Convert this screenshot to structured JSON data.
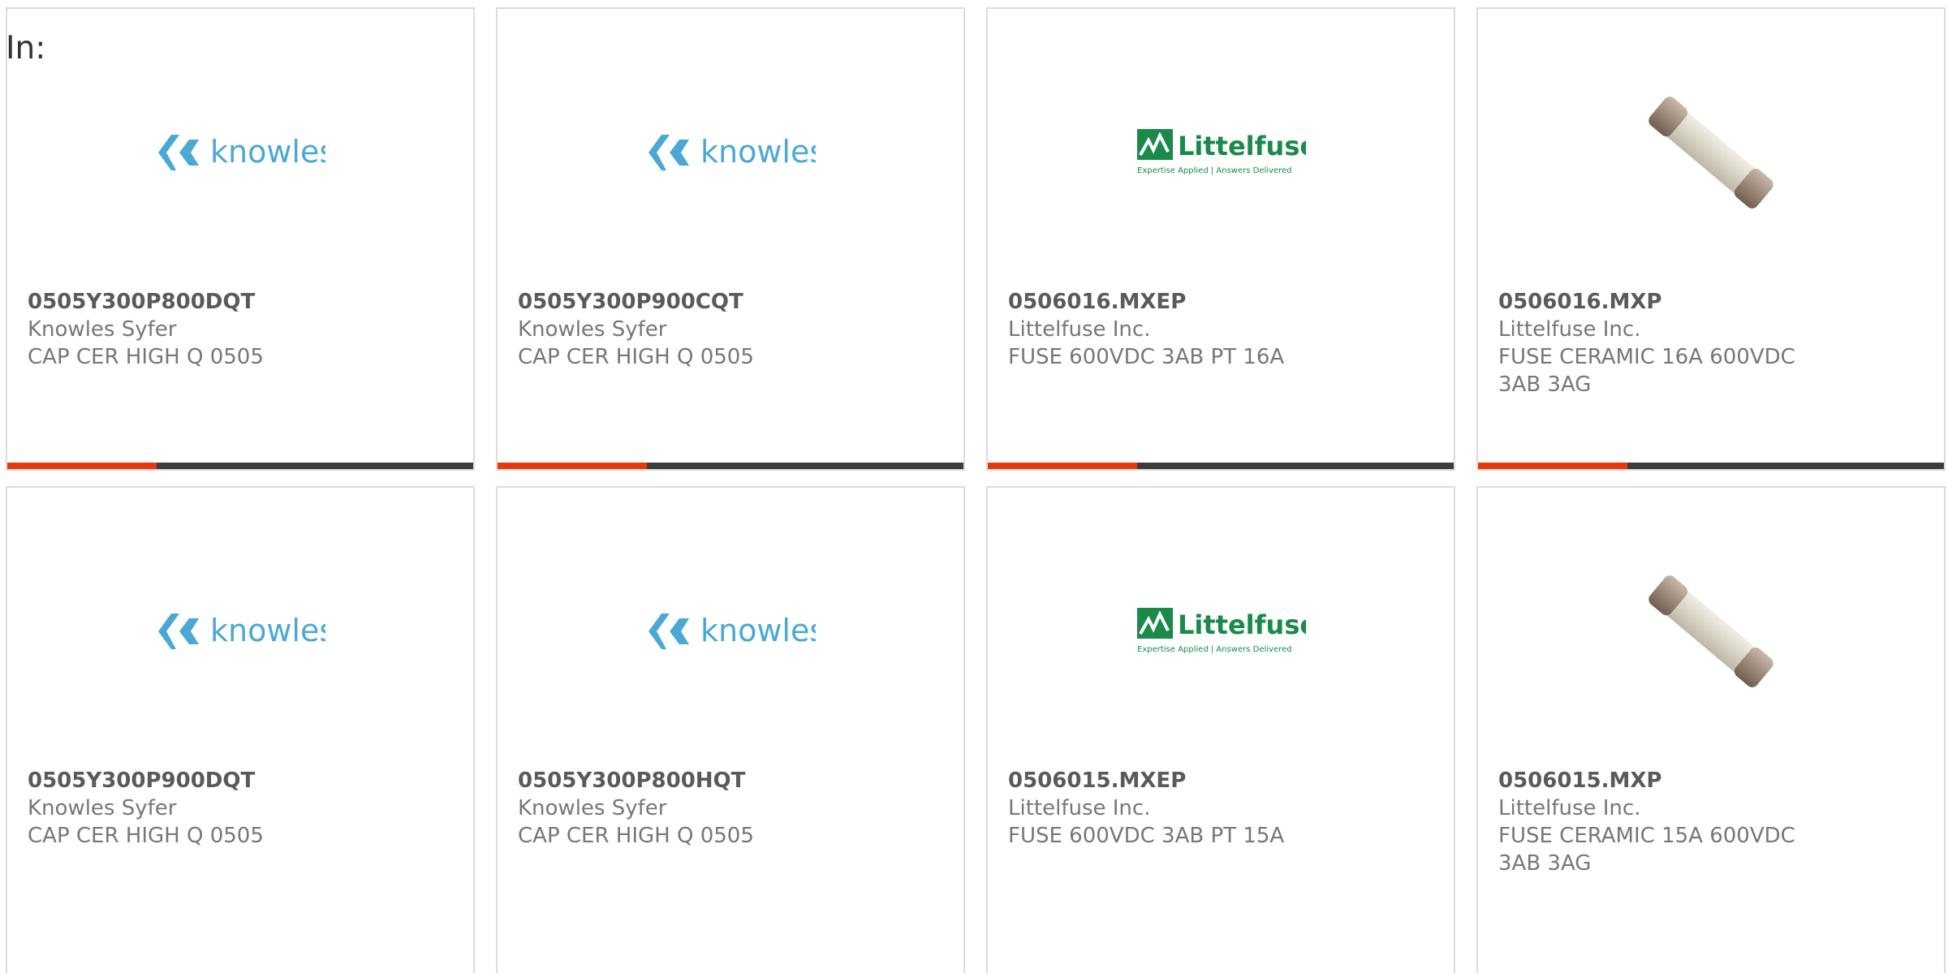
{
  "filter_label": "In:",
  "colors": {
    "bar_accent": "#e8380d",
    "bar_track": "#3d3d3d",
    "knowles_blue": "#4aa9d4",
    "littelfuse_green": "#1a8a4a"
  },
  "products": [
    {
      "part_number": "0505Y300P800DQT",
      "manufacturer": "Knowles Syfer",
      "description": "CAP CER HIGH Q 0505",
      "image": "knowles-logo",
      "logo_text": "knowles",
      "bar_fill_fraction": 0.32
    },
    {
      "part_number": "0505Y300P900CQT",
      "manufacturer": "Knowles Syfer",
      "description": "CAP CER HIGH Q 0505",
      "image": "knowles-logo",
      "logo_text": "knowles",
      "bar_fill_fraction": 0.32
    },
    {
      "part_number": "0506016.MXEP",
      "manufacturer": "Littelfuse Inc.",
      "description": "FUSE 600VDC 3AB PT 16A",
      "image": "littelfuse-logo",
      "logo_text": "Littelfuse",
      "logo_tagline": "Expertise Applied | Answers Delivered",
      "bar_fill_fraction": 0.32
    },
    {
      "part_number": "0506016.MXP",
      "manufacturer": "Littelfuse Inc.",
      "description": "FUSE CERAMIC 16A 600VDC 3AB 3AG",
      "image": "ceramic-fuse-photo",
      "bar_fill_fraction": 0.32
    },
    {
      "part_number": "0505Y300P900DQT",
      "manufacturer": "Knowles Syfer",
      "description": "CAP CER HIGH Q 0505",
      "image": "knowles-logo",
      "logo_text": "knowles"
    },
    {
      "part_number": "0505Y300P800HQT",
      "manufacturer": "Knowles Syfer",
      "description": "CAP CER HIGH Q 0505",
      "image": "knowles-logo",
      "logo_text": "knowles"
    },
    {
      "part_number": "0506015.MXEP",
      "manufacturer": "Littelfuse Inc.",
      "description": "FUSE 600VDC 3AB PT 15A",
      "image": "littelfuse-logo",
      "logo_text": "Littelfuse",
      "logo_tagline": "Expertise Applied | Answers Delivered"
    },
    {
      "part_number": "0506015.MXP",
      "manufacturer": "Littelfuse Inc.",
      "description": "FUSE CERAMIC 15A 600VDC 3AB 3AG",
      "image": "ceramic-fuse-photo"
    }
  ]
}
